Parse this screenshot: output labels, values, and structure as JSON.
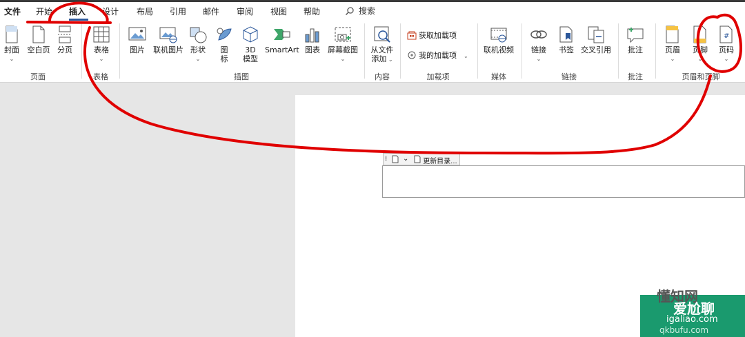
{
  "tabs": [
    "文件",
    "开始",
    "插入",
    "设计",
    "布局",
    "引用",
    "邮件",
    "审阅",
    "视图",
    "帮助"
  ],
  "search_label": "搜索",
  "groups": {
    "page": {
      "label": "页面",
      "cover": "封面",
      "blank": "空白页",
      "break": "分页"
    },
    "table": {
      "label": "表格",
      "table": "表格"
    },
    "illustrations": {
      "label": "插图",
      "picture": "图片",
      "online_picture": "联机图片",
      "shapes": "形状",
      "icons_l1": "图",
      "icons_l2": "标",
      "model_l1": "3D",
      "model_l2": "模型",
      "smartart": "SmartArt",
      "chart": "图表",
      "screenshot": "屏幕截图"
    },
    "content": {
      "label": "内容",
      "add_l1": "从文件",
      "add_l2": "添加"
    },
    "addins": {
      "label": "加载项",
      "get": "获取加载项",
      "mine": "我的加载项"
    },
    "media": {
      "label": "媒体",
      "video": "联机视频"
    },
    "links": {
      "label": "链接",
      "link": "链接",
      "bookmark": "书签",
      "crossref": "交叉引用"
    },
    "comments": {
      "label": "批注",
      "comment": "批注"
    },
    "header_footer": {
      "label": "页眉和页脚",
      "header": "页眉",
      "footer": "页脚",
      "page_number": "页码"
    }
  },
  "document": {
    "toc_update": "更新目录..."
  },
  "watermark": {
    "line1": "懂知网",
    "line2": "爱尬聊",
    "line3": "igaliao.com",
    "line4": "qkbufu.com"
  },
  "colors": {
    "accent": "#2b579a",
    "annotation": "#e00000",
    "watermark": "#1a9a6e"
  }
}
